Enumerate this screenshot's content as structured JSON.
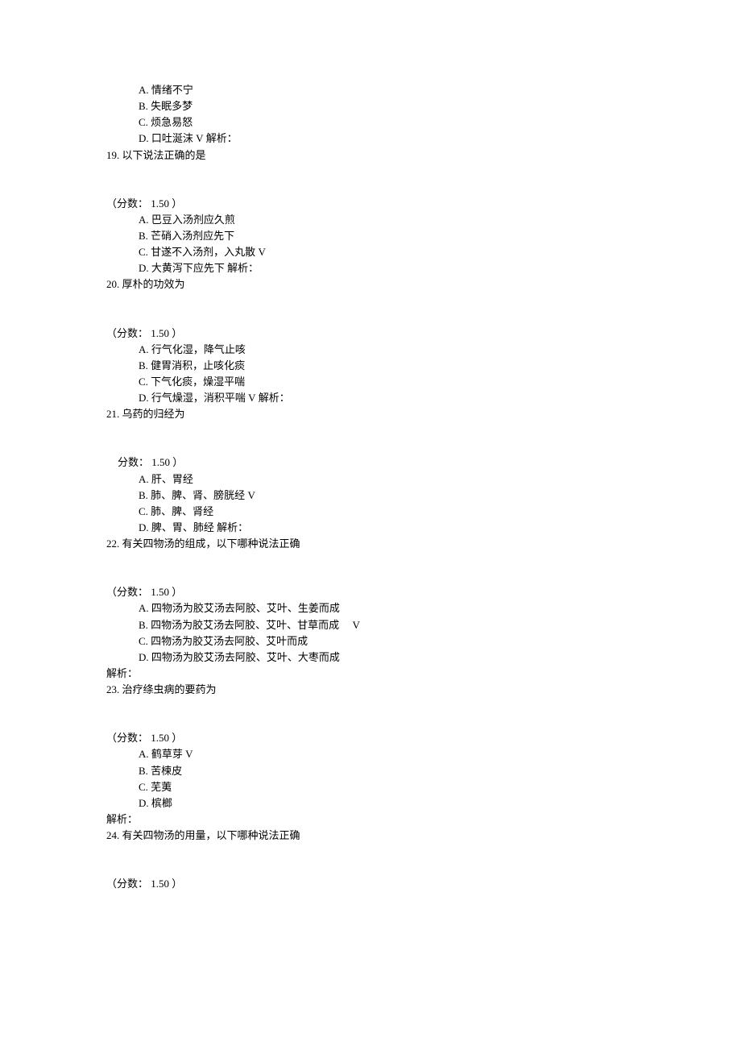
{
  "q18": {
    "optA": {
      "l": "A.",
      "t": "情绪不宁"
    },
    "optB": {
      "l": "B.",
      "t": "失眠多梦"
    },
    "optC": {
      "l": "C.",
      "t": "烦急易怒"
    },
    "optD": {
      "l": "D.",
      "t": "口吐涎沫",
      "v": "V",
      "ana": "解析："
    }
  },
  "q19": {
    "num": "19.",
    "stem": "以下说法正确的是",
    "score_l": "（分数：",
    "score_v": "1.50",
    "score_r": "）",
    "optA": {
      "l": "A.",
      "t": "巴豆入汤剂应久煎"
    },
    "optB": {
      "l": "B.",
      "t": "芒硝入汤剂应先下"
    },
    "optC": {
      "l": "C.",
      "t": "甘遂不入汤剂，入丸散",
      "v": "V"
    },
    "optD": {
      "l": "D.",
      "t": "大黄泻下应先下",
      "ana": "解析："
    }
  },
  "q20": {
    "num": "20.",
    "stem": "厚朴的功效为",
    "score_l": "（分数：",
    "score_v": "1.50",
    "score_r": "）",
    "optA": {
      "l": "A.",
      "t": "行气化湿，降气止咳"
    },
    "optB": {
      "l": "B.",
      "t": "健胃消积，止咳化痰"
    },
    "optC": {
      "l": "C.",
      "t": "下气化痰，燥湿平喘"
    },
    "optD": {
      "l": "D.",
      "t": "行气燥湿，消积平喘",
      "v": "V",
      "ana": "解析："
    }
  },
  "q21": {
    "num": "21.",
    "stem": "乌药的归经为",
    "score_l": "分数：",
    "score_v": "1.50",
    "score_r": "）",
    "optA": {
      "l": "A.",
      "t": "肝、胃经"
    },
    "optB": {
      "l": "B.",
      "t": "肺、脾、肾、膀胱经",
      "v": "V"
    },
    "optC": {
      "l": "C.",
      "t": "肺、脾、肾经"
    },
    "optD": {
      "l": "D.",
      "t": "脾、胃、肺经",
      "ana": "解析："
    }
  },
  "q22": {
    "num": "22.",
    "stem": "有关四物汤的组成，以下哪种说法正确",
    "score_l": "（分数：",
    "score_v": "1.50",
    "score_r": "）",
    "optA": {
      "l": "A.",
      "t": "四物汤为胶艾汤去阿胶、艾叶、生姜而成"
    },
    "optB": {
      "l": "B.",
      "t": "四物汤为胶艾汤去阿胶、艾叶、甘草而成",
      "v": "V"
    },
    "optC": {
      "l": "C.",
      "t": "四物汤为胶艾汤去阿胶、艾叶而成"
    },
    "optD": {
      "l": "D.",
      "t": "四物汤为胶艾汤去阿胶、艾叶、大枣而成"
    },
    "analysis": "解析："
  },
  "q23": {
    "num": "23.",
    "stem": "治疗绦虫病的要药为",
    "score_l": "（分数：",
    "score_v": "1.50",
    "score_r": "）",
    "optA": {
      "l": "A.",
      "t": "鹤草芽",
      "v": "V"
    },
    "optB": {
      "l": "B.",
      "t": "苦楝皮"
    },
    "optC": {
      "l": "C.",
      "t": "芜荑"
    },
    "optD": {
      "l": "D.",
      "t": "槟榔"
    },
    "analysis": "解析："
  },
  "q24": {
    "num": "24.",
    "stem": "有关四物汤的用量，以下哪种说法正确",
    "score_l": "（分数：",
    "score_v": "1.50",
    "score_r": "）"
  }
}
